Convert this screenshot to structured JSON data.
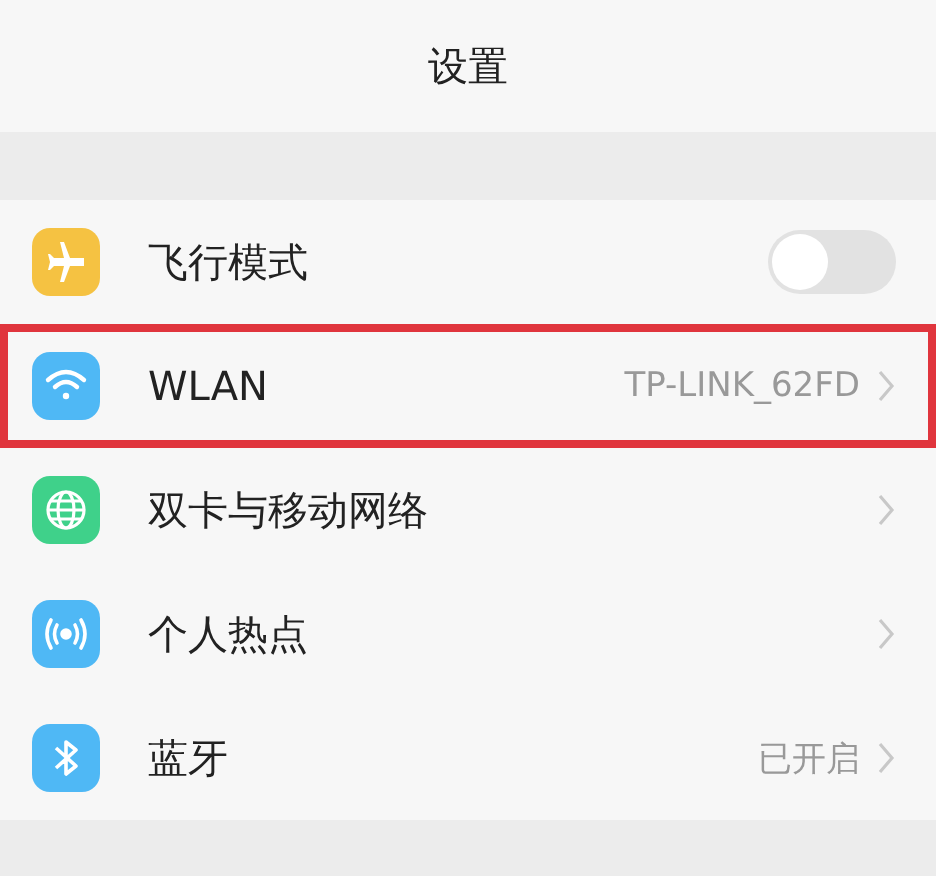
{
  "header": {
    "title": "设置"
  },
  "rows": [
    {
      "kind": "toggle",
      "label": "飞行模式",
      "color": "#f5c242",
      "on": false,
      "selected": false
    },
    {
      "kind": "link",
      "label": "WLAN",
      "value": "TP-LINK_62FD",
      "color": "#4fb8f5",
      "selected": true
    },
    {
      "kind": "link",
      "label": "双卡与移动网络",
      "color": "#3fd18a",
      "selected": false
    },
    {
      "kind": "link",
      "label": "个人热点",
      "color": "#4fb8f5",
      "selected": false
    },
    {
      "kind": "link",
      "label": "蓝牙",
      "value": "已开启",
      "color": "#4fb8f5",
      "selected": false
    }
  ]
}
